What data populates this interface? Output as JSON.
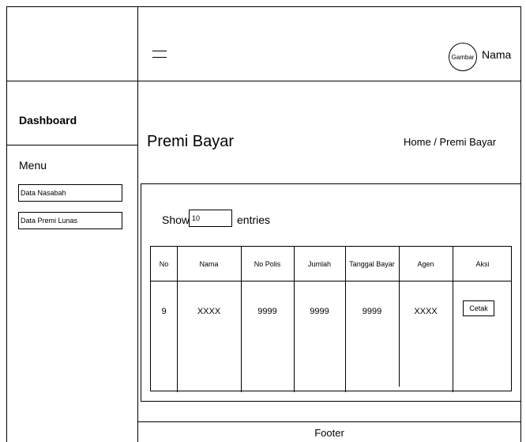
{
  "header": {
    "avatar_text": "Gambar",
    "user_name": "Nama"
  },
  "sidebar": {
    "dashboard_label": "Dashboard",
    "menu_label": "Menu",
    "items": [
      {
        "label": "Data Nasabah"
      },
      {
        "label": "Data Premi Lunas"
      }
    ]
  },
  "main": {
    "title": "Premi Bayar",
    "breadcrumb": "Home / Premi Bayar",
    "show_label": "Show",
    "entries_value": "10",
    "entries_label": "entries",
    "table": {
      "headers": [
        "No",
        "Nama",
        "No Polis",
        "Jumlah",
        "Tanggal Bayar",
        "Agen",
        "Aksi"
      ],
      "rows": [
        {
          "no": "9",
          "nama": "XXXX",
          "no_polis": "9999",
          "jumlah": "9999",
          "tanggal_bayar": "9999",
          "agen": "XXXX",
          "action": "Cetak"
        }
      ]
    }
  },
  "footer": {
    "text": "Footer"
  }
}
